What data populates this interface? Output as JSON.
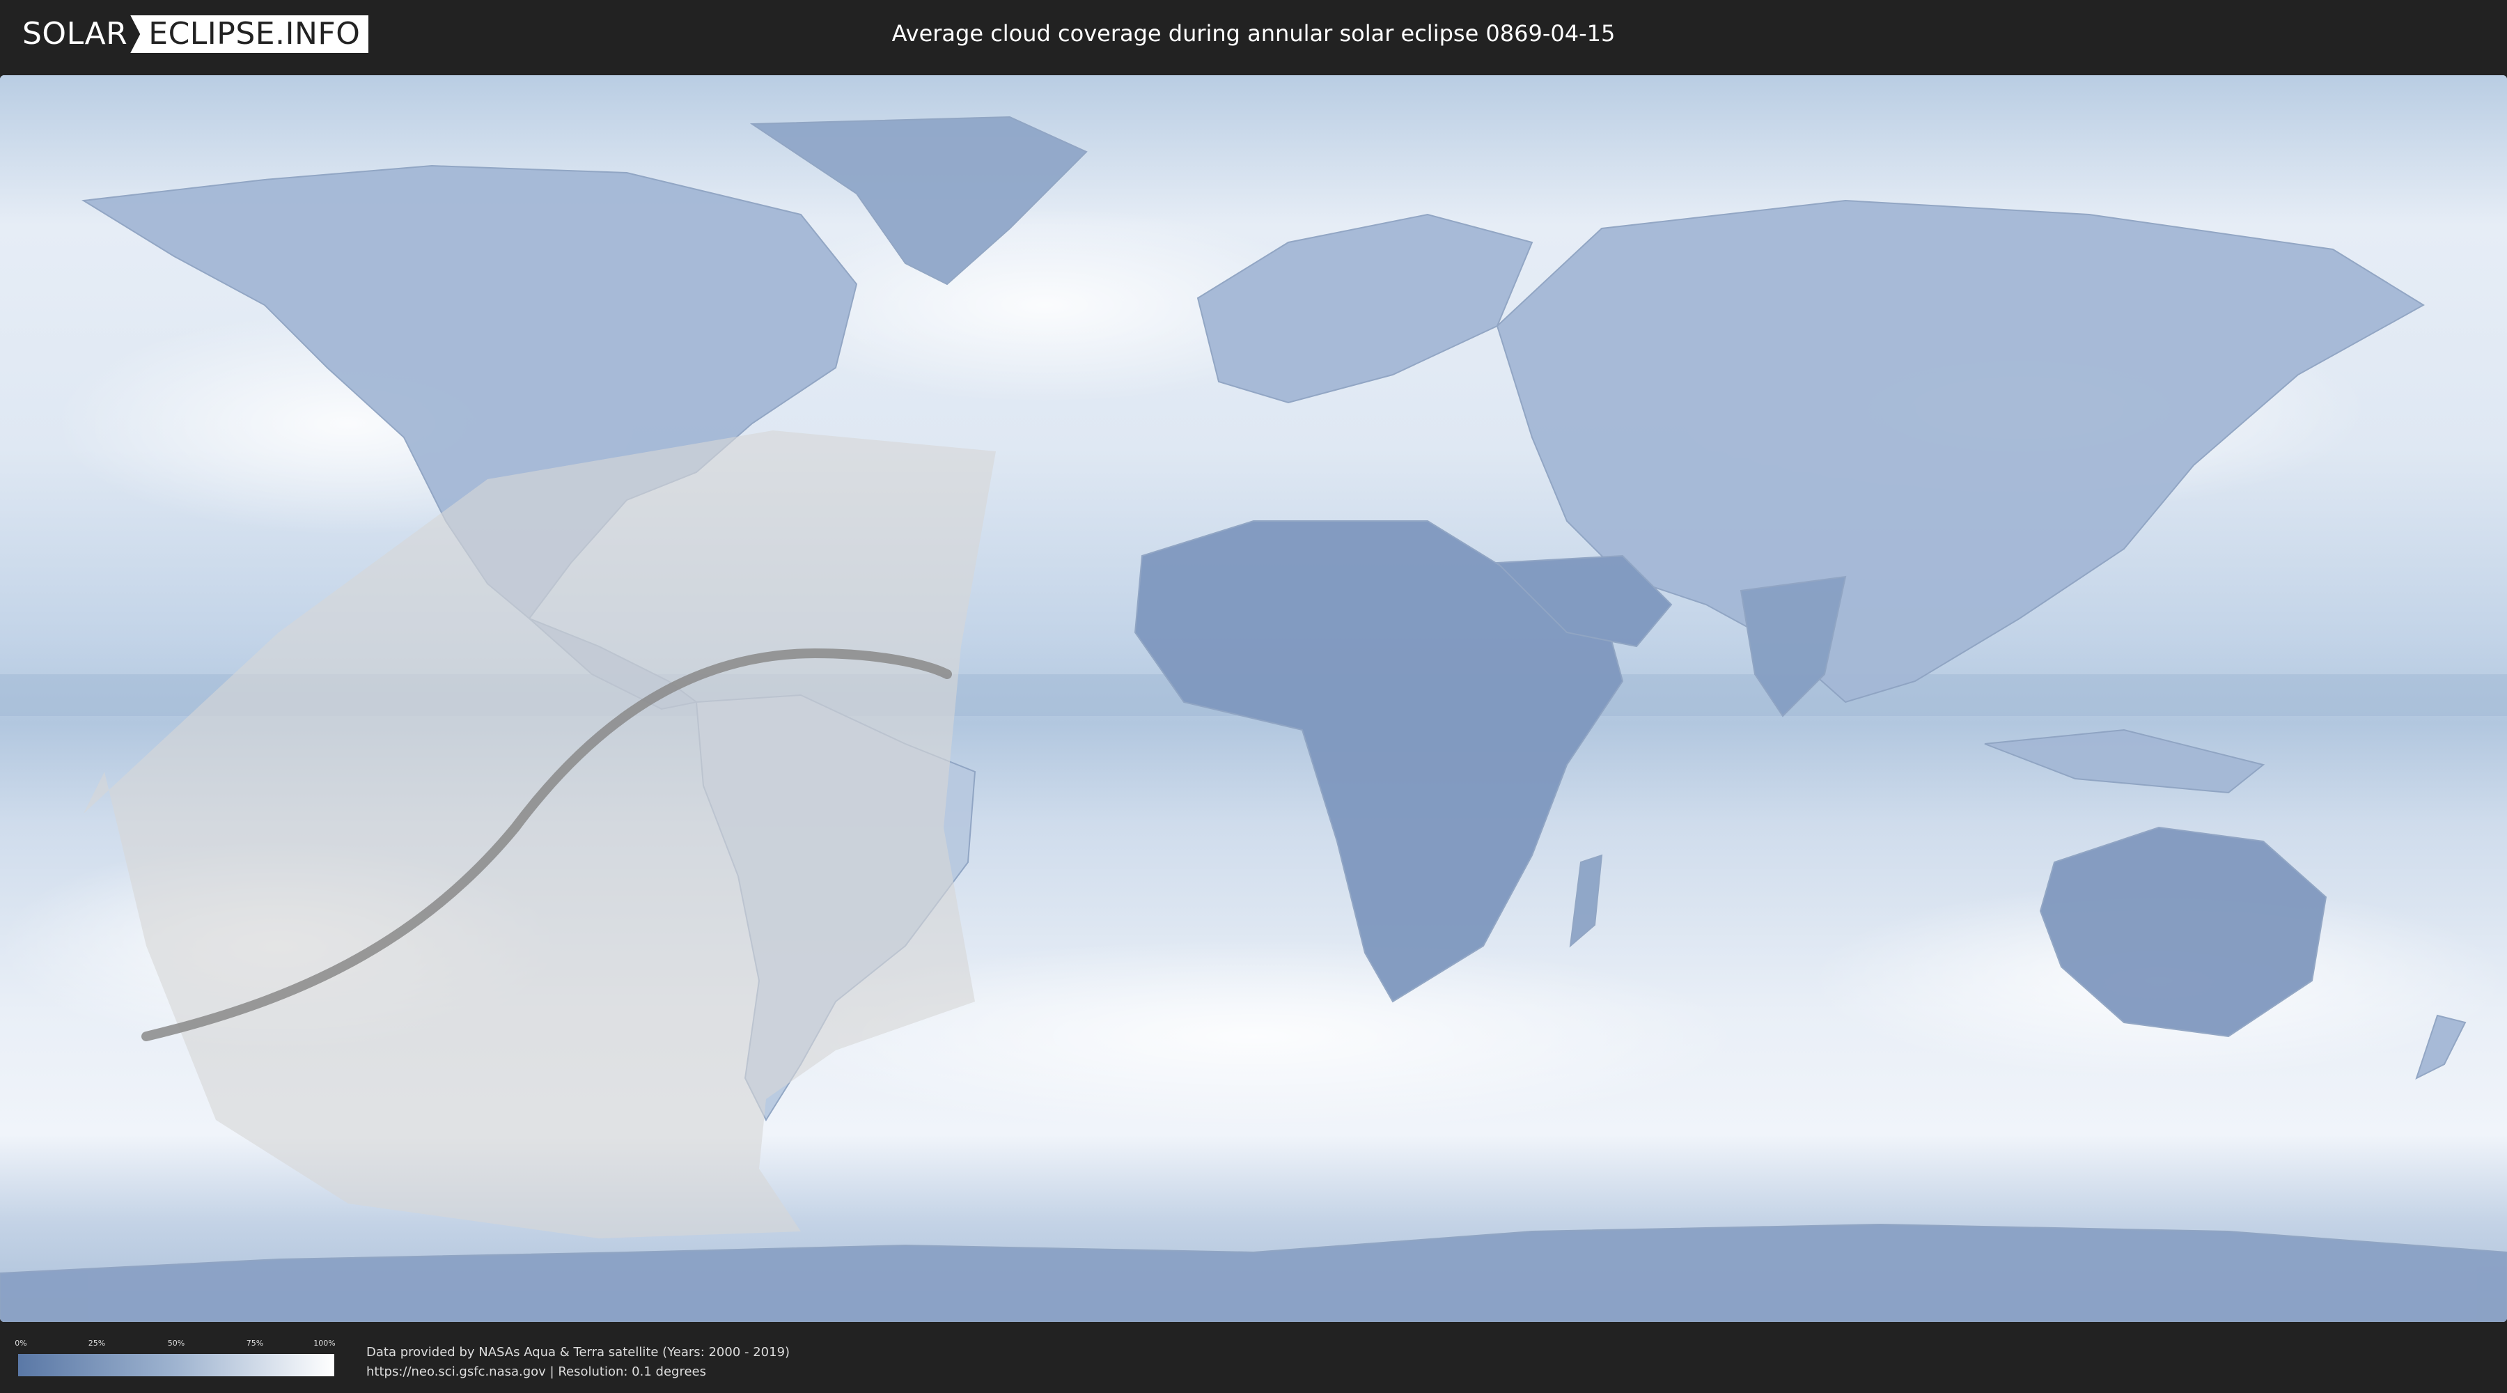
{
  "header": {
    "logo_left": "SOLAR",
    "logo_right": "ECLIPSE.INFO",
    "title": "Average cloud coverage during annular solar eclipse 0869-04-15"
  },
  "legend": {
    "ticks": [
      "0%",
      "25%",
      "50%",
      "75%",
      "100%"
    ],
    "colors": {
      "low": "#5a78a6",
      "mid": "#9fb4d0",
      "high": "#ffffff"
    }
  },
  "credits": {
    "line1": "Data provided by NASAs Aqua & Terra satellite (Years: 2000 - 2019)",
    "line2": "https://neo.sci.gsfc.nasa.gov | Resolution: 0.1 degrees"
  },
  "map": {
    "icons": [
      "world-map",
      "eclipse-penumbra-region",
      "annular-central-path"
    ],
    "colors": {
      "ocean_cloud": "#d4e0ee",
      "clear_land": "#7f98bf",
      "penumbra": "#d9d9d9",
      "central_path": "#8a8a8a"
    }
  }
}
